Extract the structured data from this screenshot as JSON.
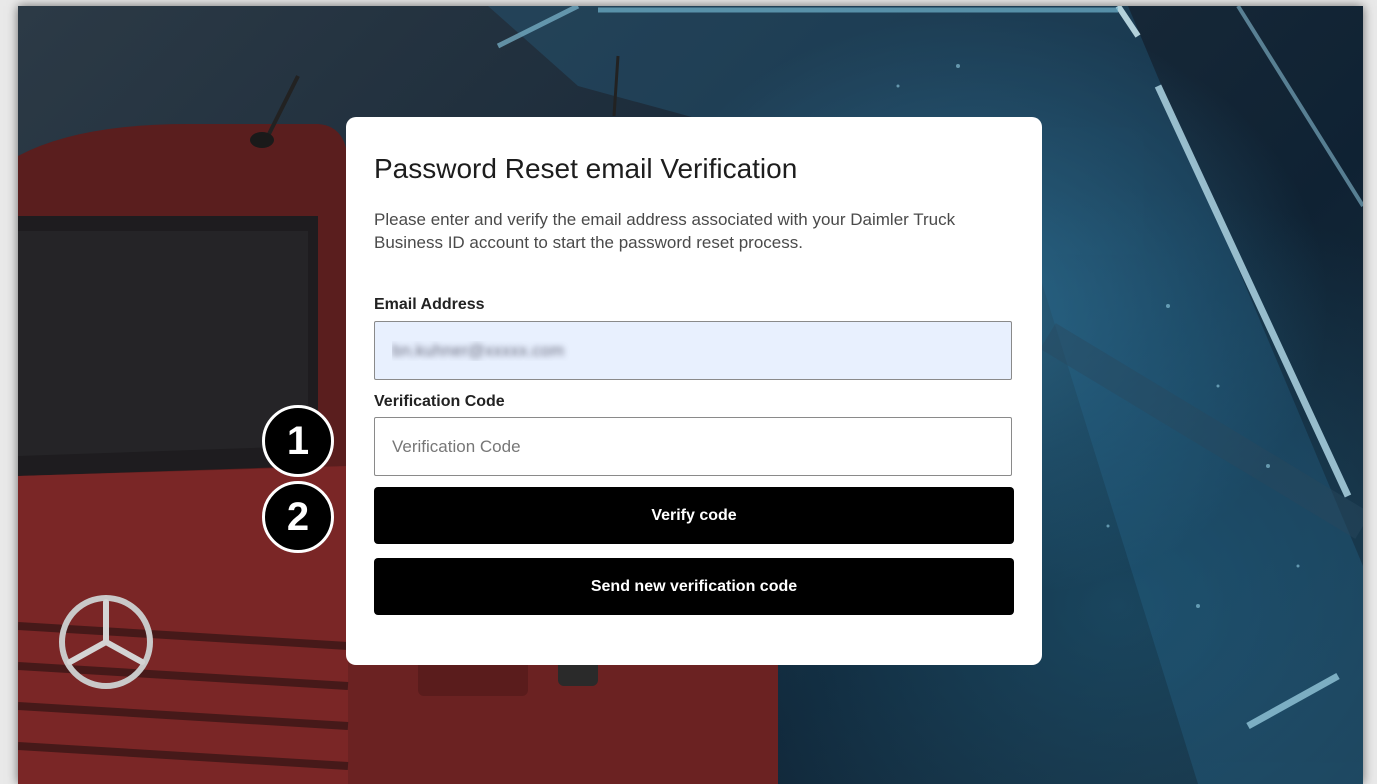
{
  "card": {
    "title": "Password Reset email Verification",
    "description": "Please enter and verify the email address associated with your Daimler Truck Business ID account to start the password reset process.",
    "email_label": "Email Address",
    "email_value": "bn.kuhner@xxxxx.com",
    "code_label": "Verification Code",
    "code_placeholder": "Verification Code",
    "verify_button": "Verify code",
    "send_button": "Send new verification code"
  },
  "annotations": {
    "step1": "1",
    "step2": "2"
  },
  "colors": {
    "button_bg": "#000000",
    "email_field_bg": "#e8f0fe",
    "card_bg": "#ffffff"
  }
}
